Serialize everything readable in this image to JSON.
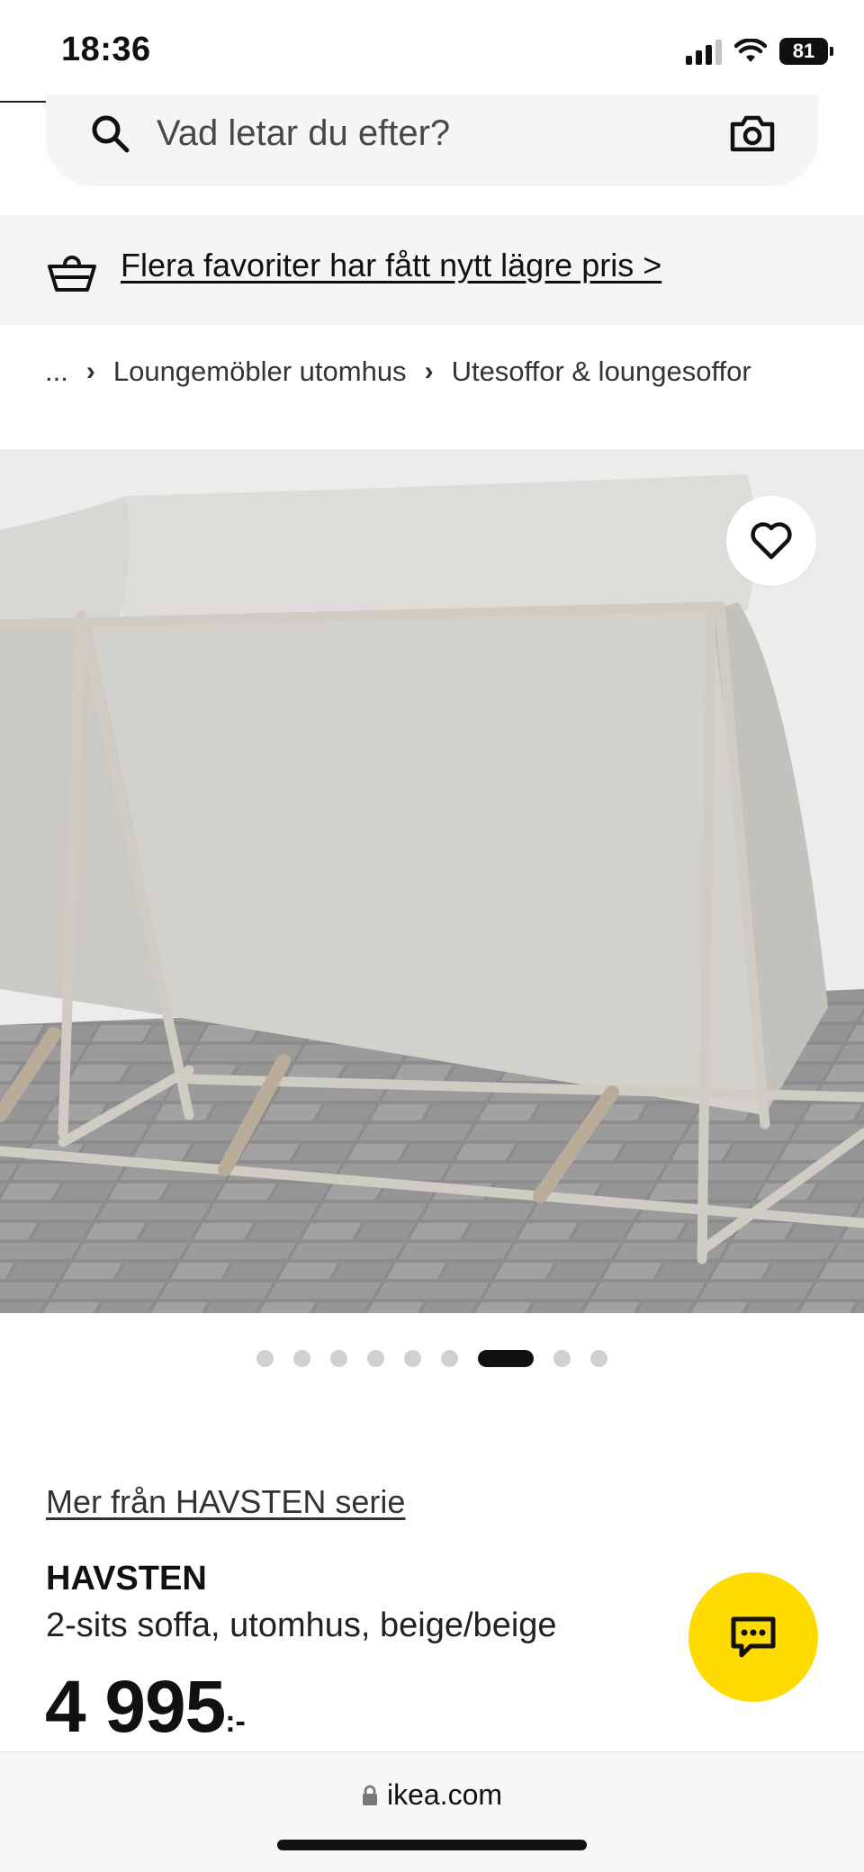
{
  "status_bar": {
    "time": "18:36",
    "battery": "81"
  },
  "search": {
    "placeholder": "Vad letar du efter?"
  },
  "promo": {
    "text": "Flera favoriter har fått nytt lägre pris >"
  },
  "breadcrumb": [
    "...",
    "Loungemöbler utomhus",
    "Utesoffor & loungesoffor"
  ],
  "carousel": {
    "total": 9,
    "active_index": 6
  },
  "product": {
    "series_link": "Mer från HAVSTEN serie",
    "name": "HAVSTEN",
    "description": "2-sits soffa, utomhus, beige/beige",
    "price": "4 995",
    "price_suffix": ":-"
  },
  "browser": {
    "url": "ikea.com"
  },
  "colors": {
    "chat_button": "#ffdb00",
    "banner_bg": "#f5f5f5"
  },
  "icons": [
    "search-icon",
    "camera-icon",
    "basket-icon",
    "heart-icon",
    "chat-icon",
    "lock-icon"
  ]
}
